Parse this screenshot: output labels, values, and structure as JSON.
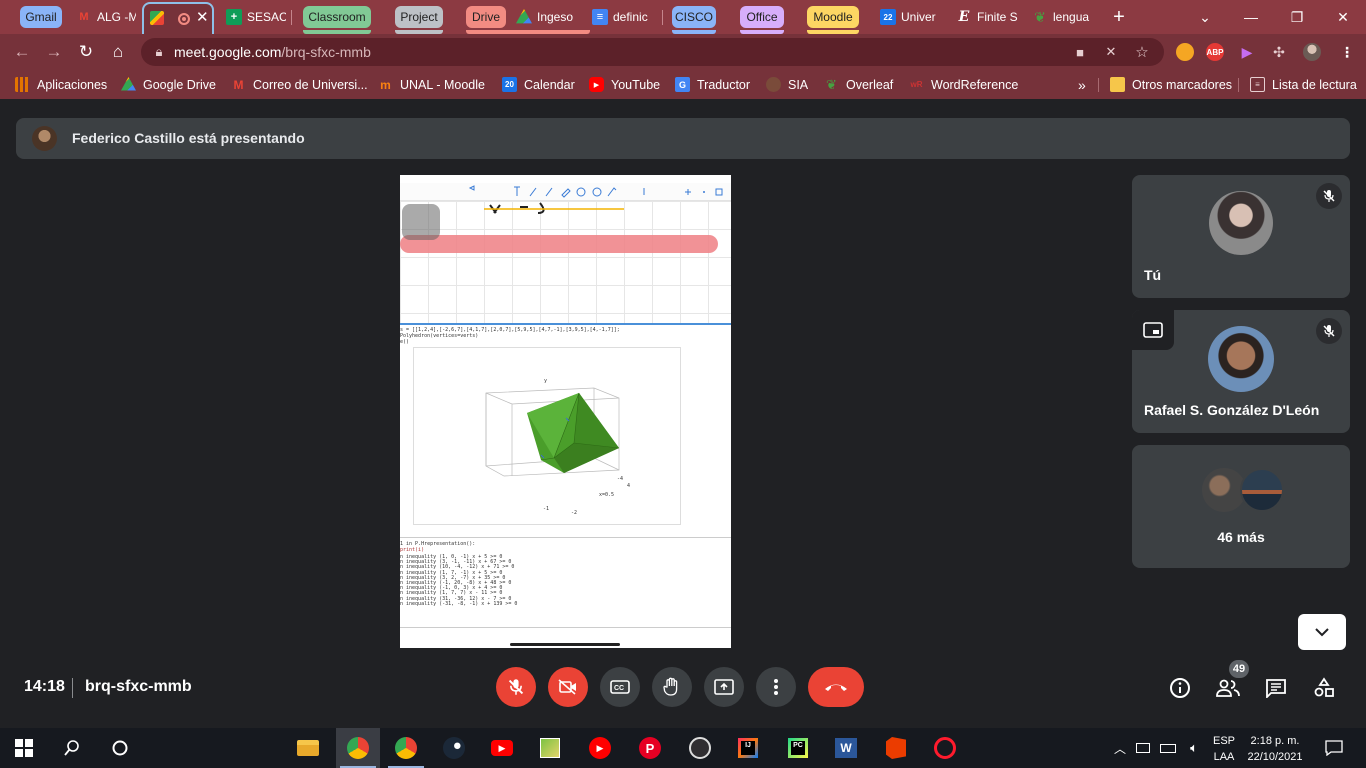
{
  "browser": {
    "tabs": [
      {
        "label": "Gmail",
        "kind": "group",
        "color": "#8ab4f8"
      },
      {
        "label": "ALG -M",
        "kind": "tab",
        "icon": "gmail-icon"
      },
      {
        "label": "",
        "kind": "active",
        "icon": "meet-icon"
      },
      {
        "label": "SESAC",
        "kind": "tab",
        "icon": "sheets-icon"
      },
      {
        "label": "Classroom",
        "kind": "group",
        "color": "#81c995"
      },
      {
        "label": "Project",
        "kind": "group",
        "color": "#bdc1c6"
      },
      {
        "label": "Drive",
        "kind": "group",
        "color": "#f28b82"
      },
      {
        "label": "Ingeso",
        "kind": "tab",
        "icon": "drive-icon"
      },
      {
        "label": "definic",
        "kind": "tab",
        "icon": "docs-icon"
      },
      {
        "label": "CISCO",
        "kind": "group",
        "color": "#8ab4f8"
      },
      {
        "label": "Office",
        "kind": "group",
        "color": "#d7aefb"
      },
      {
        "label": "Moodle",
        "kind": "group",
        "color": "#fdd663"
      },
      {
        "label": "Univer",
        "kind": "tab",
        "icon": "calendar-icon"
      },
      {
        "label": "Finite S",
        "kind": "tab",
        "icon": "e-icon"
      },
      {
        "label": "lengua",
        "kind": "tab",
        "icon": "overleaf-icon"
      }
    ],
    "new_tab": "+",
    "url_host": "meet.google.com",
    "url_path": "/brq-sfxc-mmb",
    "extensions": [
      {
        "label": "",
        "color": "#f5a623"
      },
      {
        "label": "ABP",
        "color": "#e53935"
      },
      {
        "label": "",
        "color": "#8e44ad"
      }
    ]
  },
  "bookmarks": {
    "items": [
      {
        "label": "Aplicaciones",
        "icon": "apps-grid-icon",
        "color": "#e37400"
      },
      {
        "label": "Google Drive",
        "icon": "drive-icon",
        "color": "#1e8e3e"
      },
      {
        "label": "Correo de Universi...",
        "icon": "gmail-icon",
        "color": "#d93025"
      },
      {
        "label": "UNAL - Moodle",
        "icon": "moodle-icon",
        "color": "#f98012"
      },
      {
        "label": "Calendar",
        "icon": "calendar-icon",
        "color": "#1a73e8"
      },
      {
        "label": "YouTube",
        "icon": "youtube-icon",
        "color": "#ff0000"
      },
      {
        "label": "Traductor",
        "icon": "translate-icon",
        "color": "#4285f4"
      },
      {
        "label": "SIA",
        "icon": "sia-icon",
        "color": "#7a4b3a"
      },
      {
        "label": "Overleaf",
        "icon": "overleaf-icon",
        "color": "#47a141"
      },
      {
        "label": "WordReference",
        "icon": "wordreference-icon",
        "color": "#2f4fb4"
      }
    ],
    "more": "»",
    "other_folder": "Otros marcadores",
    "reading_list": "Lista de lectura"
  },
  "meet": {
    "presenter_banner": "Federico Castillo está presentando",
    "participants": [
      {
        "name": "Tú",
        "muted": true
      },
      {
        "name": "Rafael S. González D'León",
        "muted": true
      }
    ],
    "more_participants": "46 más",
    "meeting_time": "14:18",
    "meeting_code": "brq-sfxc-mmb",
    "participant_count": "49"
  },
  "presentation": {
    "code_lines": [
      "s = [[1,2,4],[-2,6,7],[4,1,7],[2,0,7],[5,9,5],[4,7,-1],[3,9,5],[4,-1,7]];",
      "Polyhedron(vertices=verts)",
      "e()"
    ],
    "representation_lines": [
      "1 in P.Hrepresentation():",
      "print(i)"
    ],
    "inequalities": [
      "n inequality (1, 0, -1) x + 5 >= 0",
      "n inequality (3, -1, -11) x + 67 >= 0",
      "n inequality (10, -4, -12) x + 71 >= 0",
      "n inequality (1, 7, -1) x + 5 >= 0",
      "n inequality (3, 2, -7) x + 35 >= 0",
      "n inequality (-1, 20, -8) x + 48 >= 0",
      "n inequality (-1, 0, 3) x + 4 >= 0",
      "n inequality (1, 7, 7) x - 11 >= 0",
      "n inequality (31, -36, 12) x - 7 >= 0",
      "n inequality (-31, -8, -1) x + 139 >= 0"
    ],
    "axis_labels": [
      "y",
      "x",
      "-1",
      "-2",
      "4",
      "x=0.5",
      "-4"
    ]
  },
  "taskbar": {
    "lang": "ESP",
    "layout": "LAA",
    "time": "2:18 p. m.",
    "date": "22/10/2021"
  }
}
